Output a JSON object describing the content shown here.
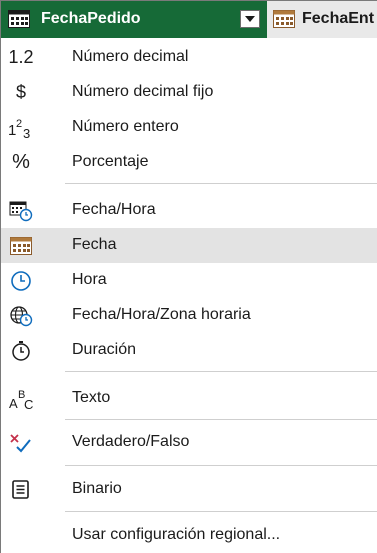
{
  "header": {
    "column_name": "FechaPedido",
    "next_column_name": "FechaEnt"
  },
  "menu": {
    "items": [
      {
        "label": "Número decimal",
        "icon": "decimal-number-icon",
        "glyph": "1.2"
      },
      {
        "label": "Número decimal fijo",
        "icon": "fixed-decimal-icon",
        "glyph": "$"
      },
      {
        "label": "Número entero",
        "icon": "whole-number-icon",
        "glyph": ""
      },
      {
        "label": "Porcentaje",
        "icon": "percentage-icon",
        "glyph": "%"
      },
      {
        "label": "Fecha/Hora",
        "icon": "datetime-icon"
      },
      {
        "label": "Fecha",
        "icon": "date-icon",
        "selected": true
      },
      {
        "label": "Hora",
        "icon": "time-icon"
      },
      {
        "label": "Fecha/Hora/Zona horaria",
        "icon": "datetime-timezone-icon"
      },
      {
        "label": "Duración",
        "icon": "duration-icon"
      },
      {
        "label": "Texto",
        "icon": "text-icon"
      },
      {
        "label": "Verdadero/Falso",
        "icon": "true-false-icon"
      },
      {
        "label": "Binario",
        "icon": "binary-icon"
      },
      {
        "label": "Usar configuración regional...",
        "icon": ""
      }
    ]
  },
  "colors": {
    "header_active": "#166a37",
    "selected_row": "#e3e3e3"
  }
}
